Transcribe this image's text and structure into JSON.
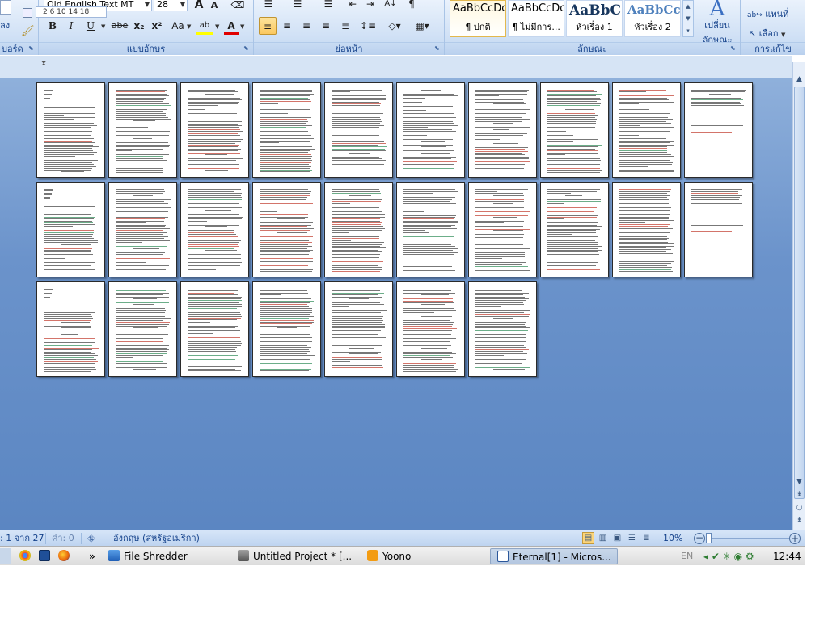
{
  "ribbon": {
    "font_group": {
      "label": "แบบอักษร",
      "font_name": "Old English Text MT",
      "font_size": "28",
      "grow_font": "A",
      "shrink_font": "A",
      "bold": "B",
      "italic": "I",
      "underline": "U",
      "strikethrough": "abe",
      "subscript": "x₂",
      "superscript": "x²",
      "change_case": "Aa",
      "highlight": "ab",
      "font_color": "A"
    },
    "clipboard_group": {
      "label": "บอร์ด",
      "partial_text": "ลง"
    },
    "paragraph_group": {
      "label": "ย่อหน้า",
      "sort": "A↓",
      "pilcrow": "¶"
    },
    "styles_group": {
      "label": "ลักษณะ",
      "change_styles": [
        "เปลี่ยน",
        "ลักษณะ"
      ],
      "styles": [
        {
          "sample": "AaBbCcDc",
          "name": "¶ ปกติ"
        },
        {
          "sample": "AaBbCcDc",
          "name": "¶ ไม่มีการ..."
        },
        {
          "sample": "AaBbC",
          "name": "หัวเรื่อง 1"
        },
        {
          "sample": "AaBbCc",
          "name": "หัวเรื่อง 2"
        }
      ]
    },
    "editing_group": {
      "label": "การแก้ไข",
      "replace": "แทนที่",
      "select": "เลือก"
    }
  },
  "ruler": {
    "text": "2  6  10  14  18"
  },
  "document": {
    "total_pages": 27
  },
  "statusbar": {
    "page_info": ": 1 จาก 27",
    "word_count": "คำ: 0",
    "language": "อังกฤษ (สหรัฐอเมริกา)",
    "zoom_label": "10%",
    "zoom_level_percent": 10
  },
  "taskbar": {
    "quicklaunch_more": "»",
    "items": [
      {
        "label": "File Shredder"
      },
      {
        "label": "Untitled Project * [..."
      },
      {
        "label": "Yoono"
      },
      {
        "label": "Eternal[1] - Micros..."
      }
    ],
    "tray": {
      "language": "EN",
      "clock": "12:44"
    }
  },
  "colors": {
    "accent": "#fbc85f",
    "ribbon": "#cfe0f5",
    "workspace": "#6b93cb"
  }
}
